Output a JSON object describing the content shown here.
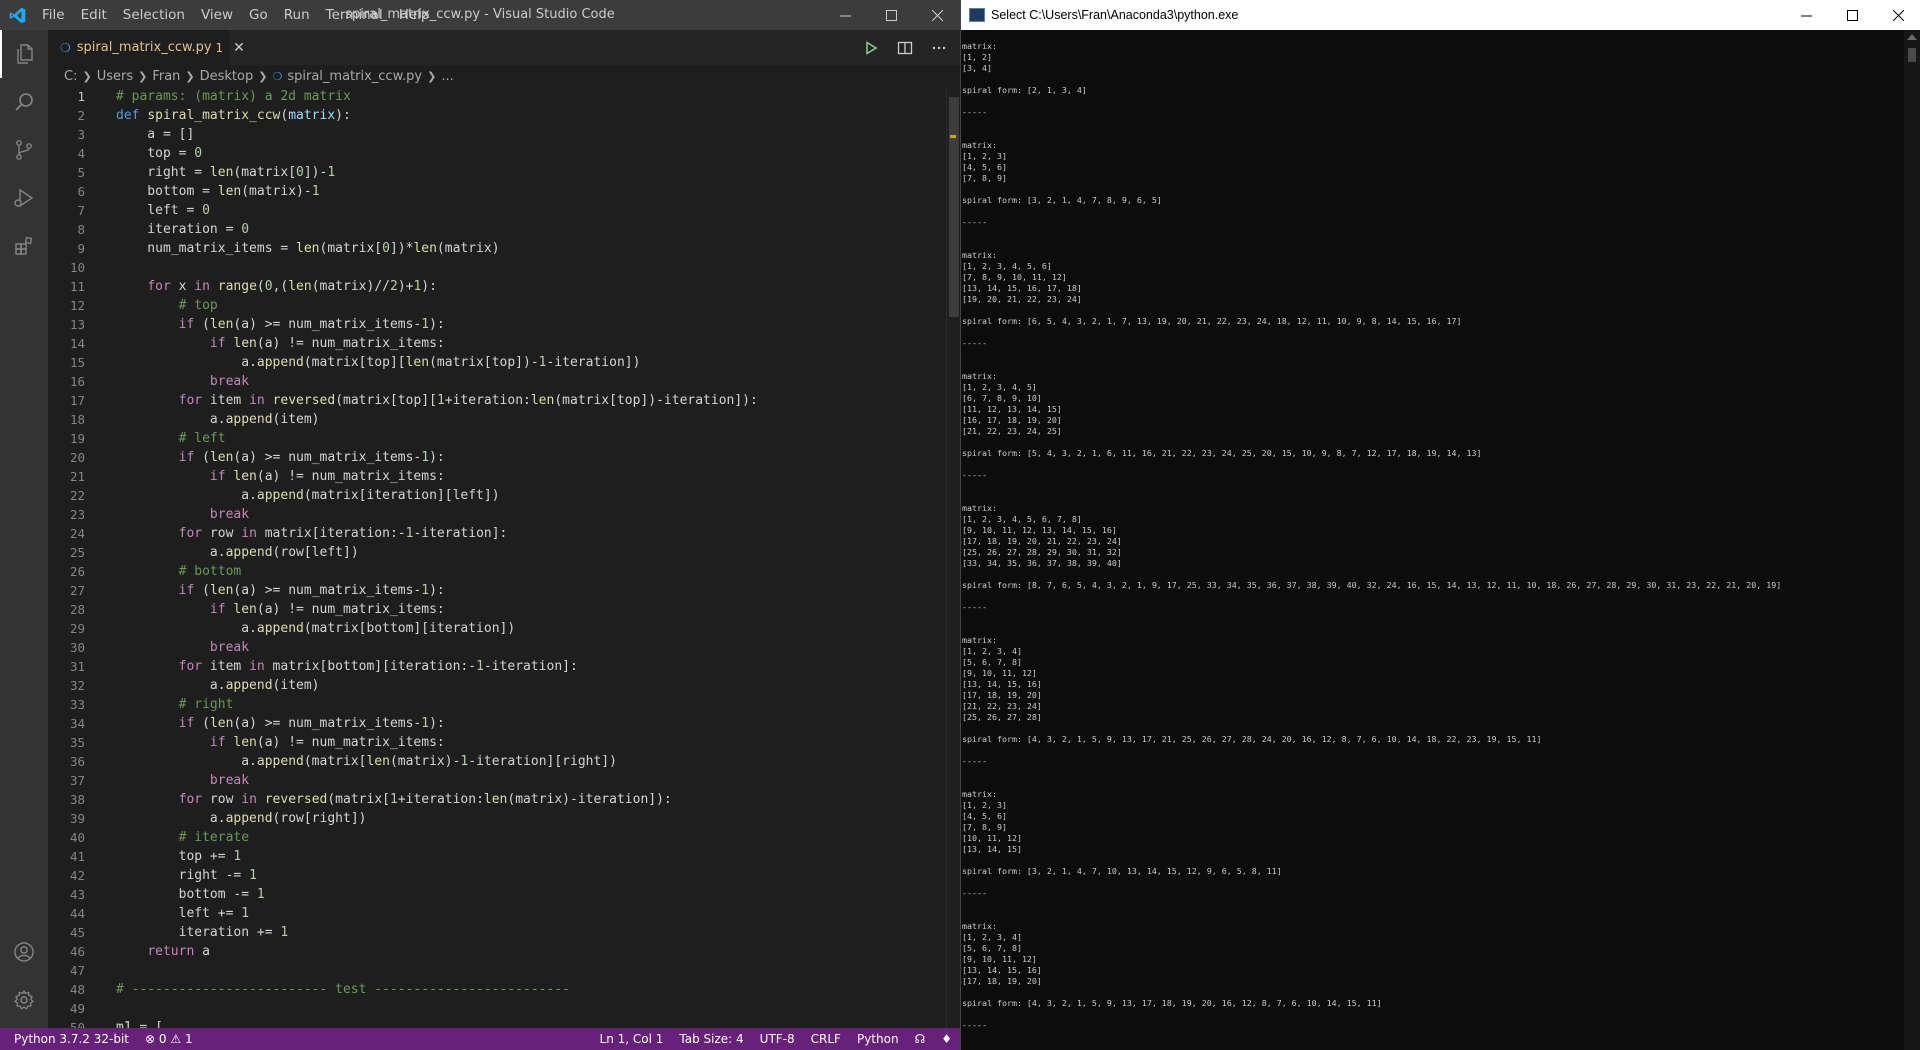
{
  "vscode": {
    "menu": [
      "File",
      "Edit",
      "Selection",
      "View",
      "Go",
      "Run",
      "Terminal",
      "Help"
    ],
    "window_title": "spiral_matrix_ccw.py - Visual Studio Code",
    "tab": {
      "label": "spiral_matrix_ccw.py",
      "badge": "1"
    },
    "breadcrumb": [
      "C:",
      "Users",
      "Fran",
      "Desktop",
      "spiral_matrix_ccw.py",
      "..."
    ],
    "active_line": 1,
    "line_numbers": [
      "1",
      "2",
      "3",
      "4",
      "5",
      "6",
      "7",
      "8",
      "9",
      "10",
      "11",
      "12",
      "13",
      "14",
      "15",
      "16",
      "17",
      "18",
      "19",
      "20",
      "21",
      "22",
      "23",
      "24",
      "25",
      "26",
      "27",
      "28",
      "29",
      "30",
      "31",
      "32",
      "33",
      "34",
      "35",
      "36",
      "37",
      "38",
      "39",
      "40",
      "41",
      "42",
      "43",
      "44",
      "45",
      "46",
      "47",
      "48",
      "49",
      "50"
    ],
    "code": [
      [
        [
          "c",
          "# params: (matrix) a 2d matrix"
        ]
      ],
      [
        [
          "k",
          "def "
        ],
        [
          "f",
          "spiral_matrix_ccw"
        ],
        [
          "p",
          "("
        ],
        [
          "v",
          "matrix"
        ],
        [
          "p",
          "):"
        ]
      ],
      [
        [
          "p",
          "    a = []"
        ]
      ],
      [
        [
          "p",
          "    top = "
        ],
        [
          "n",
          "0"
        ]
      ],
      [
        [
          "p",
          "    right = "
        ],
        [
          "f",
          "len"
        ],
        [
          "p",
          "(matrix["
        ],
        [
          "n",
          "0"
        ],
        [
          "p",
          "])-"
        ],
        [
          "n",
          "1"
        ]
      ],
      [
        [
          "p",
          "    bottom = "
        ],
        [
          "f",
          "len"
        ],
        [
          "p",
          "(matrix)-"
        ],
        [
          "n",
          "1"
        ]
      ],
      [
        [
          "p",
          "    left = "
        ],
        [
          "n",
          "0"
        ]
      ],
      [
        [
          "p",
          "    iteration = "
        ],
        [
          "n",
          "0"
        ]
      ],
      [
        [
          "p",
          "    num_matrix_items = "
        ],
        [
          "f",
          "len"
        ],
        [
          "p",
          "(matrix["
        ],
        [
          "n",
          "0"
        ],
        [
          "p",
          "])*"
        ],
        [
          "f",
          "len"
        ],
        [
          "p",
          "(matrix)"
        ]
      ],
      [],
      [
        [
          "p",
          "    "
        ],
        [
          "x",
          "for"
        ],
        [
          "p",
          " x "
        ],
        [
          "x",
          "in"
        ],
        [
          "p",
          " "
        ],
        [
          "f",
          "range"
        ],
        [
          "p",
          "("
        ],
        [
          "n",
          "0"
        ],
        [
          "p",
          ",("
        ],
        [
          "f",
          "len"
        ],
        [
          "p",
          "(matrix)//"
        ],
        [
          "n",
          "2"
        ],
        [
          "p",
          ")+"
        ],
        [
          "n",
          "1"
        ],
        [
          "p",
          "):"
        ]
      ],
      [
        [
          "p",
          "        "
        ],
        [
          "c",
          "# top"
        ]
      ],
      [
        [
          "p",
          "        "
        ],
        [
          "x",
          "if"
        ],
        [
          "p",
          " ("
        ],
        [
          "f",
          "len"
        ],
        [
          "p",
          "(a) >= num_matrix_items-"
        ],
        [
          "n",
          "1"
        ],
        [
          "p",
          "):"
        ]
      ],
      [
        [
          "p",
          "            "
        ],
        [
          "x",
          "if"
        ],
        [
          "p",
          " "
        ],
        [
          "f",
          "len"
        ],
        [
          "p",
          "(a) != num_matrix_items:"
        ]
      ],
      [
        [
          "p",
          "                a."
        ],
        [
          "f",
          "append"
        ],
        [
          "p",
          "(matrix[top]["
        ],
        [
          "f",
          "len"
        ],
        [
          "p",
          "(matrix[top])-"
        ],
        [
          "n",
          "1"
        ],
        [
          "p",
          "-iteration])"
        ]
      ],
      [
        [
          "p",
          "            "
        ],
        [
          "x",
          "break"
        ]
      ],
      [
        [
          "p",
          "        "
        ],
        [
          "x",
          "for"
        ],
        [
          "p",
          " item "
        ],
        [
          "x",
          "in"
        ],
        [
          "p",
          " "
        ],
        [
          "f",
          "reversed"
        ],
        [
          "p",
          "(matrix[top]["
        ],
        [
          "n",
          "1"
        ],
        [
          "p",
          "+iteration:"
        ],
        [
          "f",
          "len"
        ],
        [
          "p",
          "(matrix[top])-iteration]):"
        ]
      ],
      [
        [
          "p",
          "            a."
        ],
        [
          "f",
          "append"
        ],
        [
          "p",
          "(item)"
        ]
      ],
      [
        [
          "p",
          "        "
        ],
        [
          "c",
          "# left"
        ]
      ],
      [
        [
          "p",
          "        "
        ],
        [
          "x",
          "if"
        ],
        [
          "p",
          " ("
        ],
        [
          "f",
          "len"
        ],
        [
          "p",
          "(a) >= num_matrix_items-"
        ],
        [
          "n",
          "1"
        ],
        [
          "p",
          "):"
        ]
      ],
      [
        [
          "p",
          "            "
        ],
        [
          "x",
          "if"
        ],
        [
          "p",
          " "
        ],
        [
          "f",
          "len"
        ],
        [
          "p",
          "(a) != num_matrix_items:"
        ]
      ],
      [
        [
          "p",
          "                a."
        ],
        [
          "f",
          "append"
        ],
        [
          "p",
          "(matrix[iteration][left])"
        ]
      ],
      [
        [
          "p",
          "            "
        ],
        [
          "x",
          "break"
        ]
      ],
      [
        [
          "p",
          "        "
        ],
        [
          "x",
          "for"
        ],
        [
          "p",
          " row "
        ],
        [
          "x",
          "in"
        ],
        [
          "p",
          " matrix[iteration:-"
        ],
        [
          "n",
          "1"
        ],
        [
          "p",
          "-iteration]:"
        ]
      ],
      [
        [
          "p",
          "            a."
        ],
        [
          "f",
          "append"
        ],
        [
          "p",
          "(row[left])"
        ]
      ],
      [
        [
          "p",
          "        "
        ],
        [
          "c",
          "# bottom"
        ]
      ],
      [
        [
          "p",
          "        "
        ],
        [
          "x",
          "if"
        ],
        [
          "p",
          " ("
        ],
        [
          "f",
          "len"
        ],
        [
          "p",
          "(a) >= num_matrix_items-"
        ],
        [
          "n",
          "1"
        ],
        [
          "p",
          "):"
        ]
      ],
      [
        [
          "p",
          "            "
        ],
        [
          "x",
          "if"
        ],
        [
          "p",
          " "
        ],
        [
          "f",
          "len"
        ],
        [
          "p",
          "(a) != num_matrix_items:"
        ]
      ],
      [
        [
          "p",
          "                a."
        ],
        [
          "f",
          "append"
        ],
        [
          "p",
          "(matrix[bottom][iteration])"
        ]
      ],
      [
        [
          "p",
          "            "
        ],
        [
          "x",
          "break"
        ]
      ],
      [
        [
          "p",
          "        "
        ],
        [
          "x",
          "for"
        ],
        [
          "p",
          " item "
        ],
        [
          "x",
          "in"
        ],
        [
          "p",
          " matrix[bottom][iteration:-"
        ],
        [
          "n",
          "1"
        ],
        [
          "p",
          "-iteration]:"
        ]
      ],
      [
        [
          "p",
          "            a."
        ],
        [
          "f",
          "append"
        ],
        [
          "p",
          "(item)"
        ]
      ],
      [
        [
          "p",
          "        "
        ],
        [
          "c",
          "# right"
        ]
      ],
      [
        [
          "p",
          "        "
        ],
        [
          "x",
          "if"
        ],
        [
          "p",
          " ("
        ],
        [
          "f",
          "len"
        ],
        [
          "p",
          "(a) >= num_matrix_items-"
        ],
        [
          "n",
          "1"
        ],
        [
          "p",
          "):"
        ]
      ],
      [
        [
          "p",
          "            "
        ],
        [
          "x",
          "if"
        ],
        [
          "p",
          " "
        ],
        [
          "f",
          "len"
        ],
        [
          "p",
          "(a) != num_matrix_items:"
        ]
      ],
      [
        [
          "p",
          "                a."
        ],
        [
          "f",
          "append"
        ],
        [
          "p",
          "(matrix["
        ],
        [
          "f",
          "len"
        ],
        [
          "p",
          "(matrix)-"
        ],
        [
          "n",
          "1"
        ],
        [
          "p",
          "-iteration][right])"
        ]
      ],
      [
        [
          "p",
          "            "
        ],
        [
          "x",
          "break"
        ]
      ],
      [
        [
          "p",
          "        "
        ],
        [
          "x",
          "for"
        ],
        [
          "p",
          " row "
        ],
        [
          "x",
          "in"
        ],
        [
          "p",
          " "
        ],
        [
          "f",
          "reversed"
        ],
        [
          "p",
          "(matrix["
        ],
        [
          "n",
          "1"
        ],
        [
          "p",
          "+iteration:"
        ],
        [
          "f",
          "len"
        ],
        [
          "p",
          "(matrix)-iteration]):"
        ]
      ],
      [
        [
          "p",
          "            a."
        ],
        [
          "f",
          "append"
        ],
        [
          "p",
          "(row[right])"
        ]
      ],
      [
        [
          "p",
          "        "
        ],
        [
          "c",
          "# iterate"
        ]
      ],
      [
        [
          "p",
          "        top += "
        ],
        [
          "n",
          "1"
        ]
      ],
      [
        [
          "p",
          "        right -= "
        ],
        [
          "n",
          "1"
        ]
      ],
      [
        [
          "p",
          "        bottom -= "
        ],
        [
          "n",
          "1"
        ]
      ],
      [
        [
          "p",
          "        left += "
        ],
        [
          "n",
          "1"
        ]
      ],
      [
        [
          "p",
          "        iteration += "
        ],
        [
          "n",
          "1"
        ]
      ],
      [
        [
          "p",
          "    "
        ],
        [
          "x",
          "return"
        ],
        [
          "p",
          " a"
        ]
      ],
      [],
      [
        [
          "c",
          "# ------------------------- test -------------------------"
        ]
      ],
      [],
      [
        [
          "p",
          "m1 = ["
        ]
      ]
    ],
    "status": {
      "python": "Python 3.7.2 32-bit",
      "errors": "0",
      "warnings": "1",
      "position": "Ln 1, Col 1",
      "tab_size": "Tab Size: 4",
      "encoding": "UTF-8",
      "eol": "CRLF",
      "language": "Python"
    }
  },
  "console": {
    "title": "Select C:\\Users\\Fran\\Anaconda3\\python.exe",
    "lines": [
      "",
      "matrix:",
      "[1, 2]",
      "[3, 4]",
      "",
      "spiral form: [2, 1, 3, 4]",
      "",
      "-----",
      "",
      "",
      "matrix:",
      "[1, 2, 3]",
      "[4, 5, 6]",
      "[7, 8, 9]",
      "",
      "spiral form: [3, 2, 1, 4, 7, 8, 9, 6, 5]",
      "",
      "-----",
      "",
      "",
      "matrix:",
      "[1, 2, 3, 4, 5, 6]",
      "[7, 8, 9, 10, 11, 12]",
      "[13, 14, 15, 16, 17, 18]",
      "[19, 20, 21, 22, 23, 24]",
      "",
      "spiral form: [6, 5, 4, 3, 2, 1, 7, 13, 19, 20, 21, 22, 23, 24, 18, 12, 11, 10, 9, 8, 14, 15, 16, 17]",
      "",
      "-----",
      "",
      "",
      "matrix:",
      "[1, 2, 3, 4, 5]",
      "[6, 7, 8, 9, 10]",
      "[11, 12, 13, 14, 15]",
      "[16, 17, 18, 19, 20]",
      "[21, 22, 23, 24, 25]",
      "",
      "spiral form: [5, 4, 3, 2, 1, 6, 11, 16, 21, 22, 23, 24, 25, 20, 15, 10, 9, 8, 7, 12, 17, 18, 19, 14, 13]",
      "",
      "-----",
      "",
      "",
      "matrix:",
      "[1, 2, 3, 4, 5, 6, 7, 8]",
      "[9, 10, 11, 12, 13, 14, 15, 16]",
      "[17, 18, 19, 20, 21, 22, 23, 24]",
      "[25, 26, 27, 28, 29, 30, 31, 32]",
      "[33, 34, 35, 36, 37, 38, 39, 40]",
      "",
      "spiral form: [8, 7, 6, 5, 4, 3, 2, 1, 9, 17, 25, 33, 34, 35, 36, 37, 38, 39, 40, 32, 24, 16, 15, 14, 13, 12, 11, 10, 18, 26, 27, 28, 29, 30, 31, 23, 22, 21, 20, 19]",
      "",
      "-----",
      "",
      "",
      "matrix:",
      "[1, 2, 3, 4]",
      "[5, 6, 7, 8]",
      "[9, 10, 11, 12]",
      "[13, 14, 15, 16]",
      "[17, 18, 19, 20]",
      "[21, 22, 23, 24]",
      "[25, 26, 27, 28]",
      "",
      "spiral form: [4, 3, 2, 1, 5, 9, 13, 17, 21, 25, 26, 27, 28, 24, 20, 16, 12, 8, 7, 6, 10, 14, 18, 22, 23, 19, 15, 11]",
      "",
      "-----",
      "",
      "",
      "matrix:",
      "[1, 2, 3]",
      "[4, 5, 6]",
      "[7, 8, 9]",
      "[10, 11, 12]",
      "[13, 14, 15]",
      "",
      "spiral form: [3, 2, 1, 4, 7, 10, 13, 14, 15, 12, 9, 6, 5, 8, 11]",
      "",
      "-----",
      "",
      "",
      "matrix:",
      "[1, 2, 3, 4]",
      "[5, 6, 7, 8]",
      "[9, 10, 11, 12]",
      "[13, 14, 15, 16]",
      "[17, 18, 19, 20]",
      "",
      "spiral form: [4, 3, 2, 1, 5, 9, 13, 17, 18, 19, 20, 16, 12, 8, 7, 6, 10, 14, 15, 11]",
      "",
      "-----"
    ]
  },
  "colors": {
    "statusbar": "#68217a",
    "titlebar": "#3c3c3c",
    "activitybar": "#333333",
    "editor_bg": "#1e1e1e",
    "console_bg": "#0c0c0c",
    "run_icon": "#89d185",
    "tab_modified": "#e2c08d"
  },
  "icons": {
    "app": "vscode-logo-icon",
    "activity": [
      "explorer-icon",
      "search-icon",
      "source-control-icon",
      "run-debug-icon",
      "extensions-icon",
      "account-icon",
      "settings-gear-icon"
    ],
    "editor_actions": [
      "run-python-file-icon",
      "split-editor-icon",
      "more-actions-icon"
    ]
  }
}
